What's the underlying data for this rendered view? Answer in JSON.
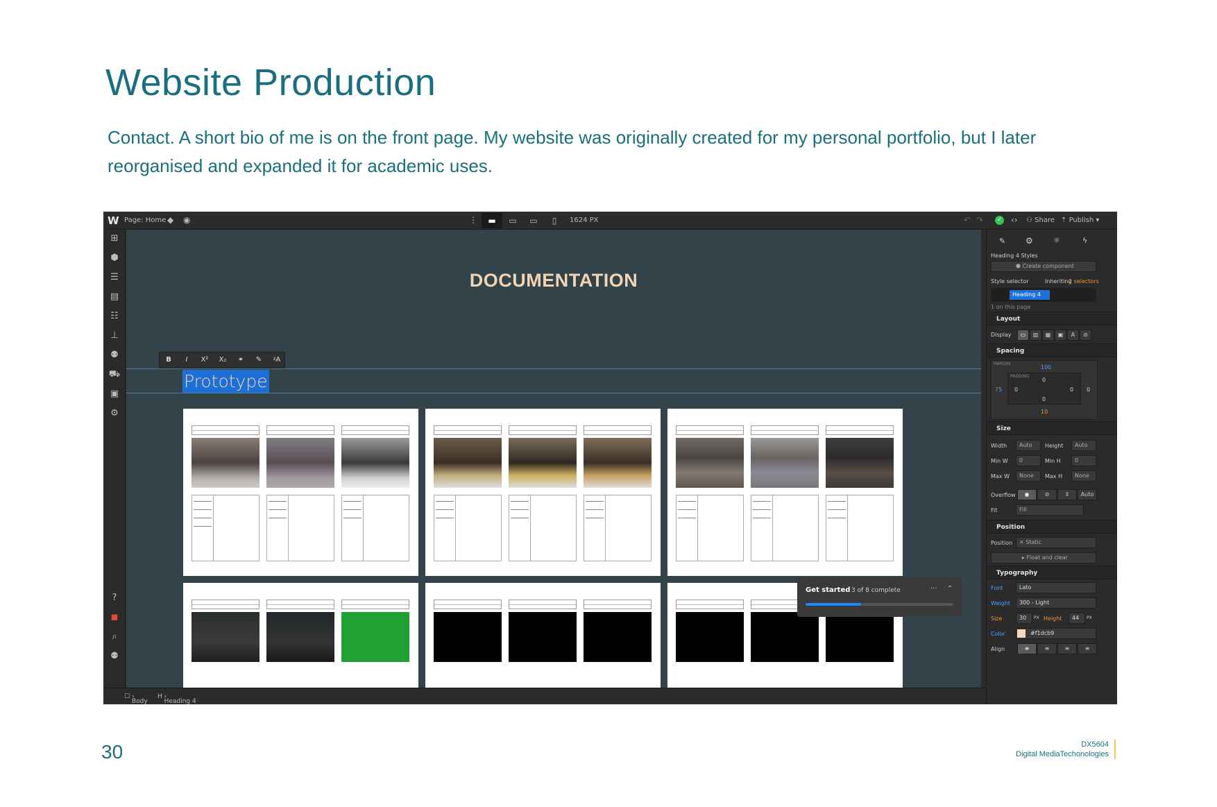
{
  "slide": {
    "title": "Website Production",
    "intro": "Contact. A short bio of me is on the front page. My website was originally created for my personal portfolio, but I later reorganised and expanded it for academic uses.",
    "page_number": "30",
    "course_code": "DX5604",
    "course_name": "Digital MediaTechonologies",
    "accent_color": "#1a6f7e",
    "footer_rule_color": "#f0c75a"
  },
  "topbar": {
    "logo": "W",
    "page_label": "Page: Home",
    "viewport_width": "1624 PX",
    "share_label": "Share",
    "publish_label": "Publish"
  },
  "canvas": {
    "heading": "DOCUMENTATION",
    "selected_text": "Prototype",
    "background_color": "#33434a",
    "heading_color": "#f1d4b5",
    "format_toolbar": [
      "B",
      "I",
      "X²",
      "X₂",
      "link-icon",
      "brush-icon",
      "clear-format-icon"
    ]
  },
  "breadcrumb": [
    "Body",
    "Heading 4"
  ],
  "toast": {
    "title": "Get started",
    "progress_text": "3 of 8 complete"
  },
  "panel": {
    "selected_element": "Heading 4 Styles",
    "create_component": "Create component",
    "style_selector_label": "Style selector",
    "inheriting": "Inheriting",
    "inheriting_count": "2 selectors",
    "selector_chip": "Heading 4",
    "on_page": "1 on this page",
    "layout": {
      "title": "Layout",
      "display_label": "Display"
    },
    "spacing": {
      "title": "Spacing",
      "margin_label": "MARGIN",
      "padding_label": "PADDING",
      "margin_top": "100",
      "margin_left": "75",
      "margin_right": "0",
      "margin_bottom": "10",
      "padding_top": "0",
      "padding_left": "0",
      "padding_right": "0",
      "padding_bottom": "0"
    },
    "size": {
      "title": "Size",
      "width_label": "Width",
      "width_value": "Auto",
      "height_label": "Height",
      "height_value": "Auto",
      "min_w_label": "Min W",
      "min_w_value": "0",
      "min_h_label": "Min H",
      "min_h_value": "0",
      "max_w_label": "Max W",
      "max_w_value": "None",
      "max_h_label": "Max H",
      "max_h_value": "None",
      "unit": "PX",
      "overflow_label": "Overflow",
      "overflow_auto": "Auto",
      "fit_label": "Fit",
      "fit_value": "Fill"
    },
    "position": {
      "title": "Position",
      "position_label": "Position",
      "position_value": "Static",
      "float_label": "Float and clear"
    },
    "typography": {
      "title": "Typography",
      "font_label": "Font",
      "font_value": "Lato",
      "weight_label": "Weight",
      "weight_value": "300 - Light",
      "size_label": "Size",
      "size_value": "30",
      "size_unit": "PX",
      "height_label": "Height",
      "height_value": "44",
      "height_unit": "PX",
      "color_label": "Color",
      "color_value": "#f1dcb9",
      "align_label": "Align"
    }
  }
}
